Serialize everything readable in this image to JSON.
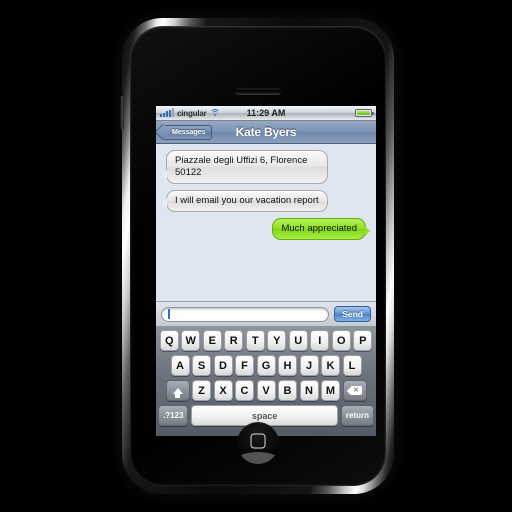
{
  "device": {
    "name": "iphone",
    "earpiece": "earpiece-speaker",
    "home_button": "home-button"
  },
  "status_bar": {
    "carrier": "cingular",
    "signal_icon": "signal-bars-icon",
    "wifi_icon": "wifi-icon",
    "time": "11:29 AM",
    "battery_icon": "battery-icon",
    "battery_color": "#7ed321"
  },
  "nav_bar": {
    "back_label": "Messages",
    "title": "Kate Byers",
    "accent": "#7e94b4"
  },
  "conversation": {
    "messages": [
      {
        "text": "Piazzale degli Uffizi 6, Florence 50122",
        "side": "incoming"
      },
      {
        "text": "I will email you our vacation report",
        "side": "incoming"
      },
      {
        "text": "Much appreciated",
        "side": "outgoing"
      }
    ],
    "incoming_color": "#e6e6e6",
    "outgoing_color": "#8fe024"
  },
  "compose": {
    "input_value": "",
    "input_placeholder": "",
    "send_label": "Send",
    "send_color": "#5e93d3"
  },
  "keyboard": {
    "row1": [
      "Q",
      "W",
      "E",
      "R",
      "T",
      "Y",
      "U",
      "I",
      "O",
      "P"
    ],
    "row2": [
      "A",
      "S",
      "D",
      "F",
      "G",
      "H",
      "J",
      "K",
      "L"
    ],
    "row3": [
      "Z",
      "X",
      "C",
      "V",
      "B",
      "N",
      "M"
    ],
    "shift_icon": "shift-arrow-icon",
    "delete_icon": "delete-backspace-icon",
    "numeric_label": ".?123",
    "space_label": "space",
    "return_label": "return"
  }
}
